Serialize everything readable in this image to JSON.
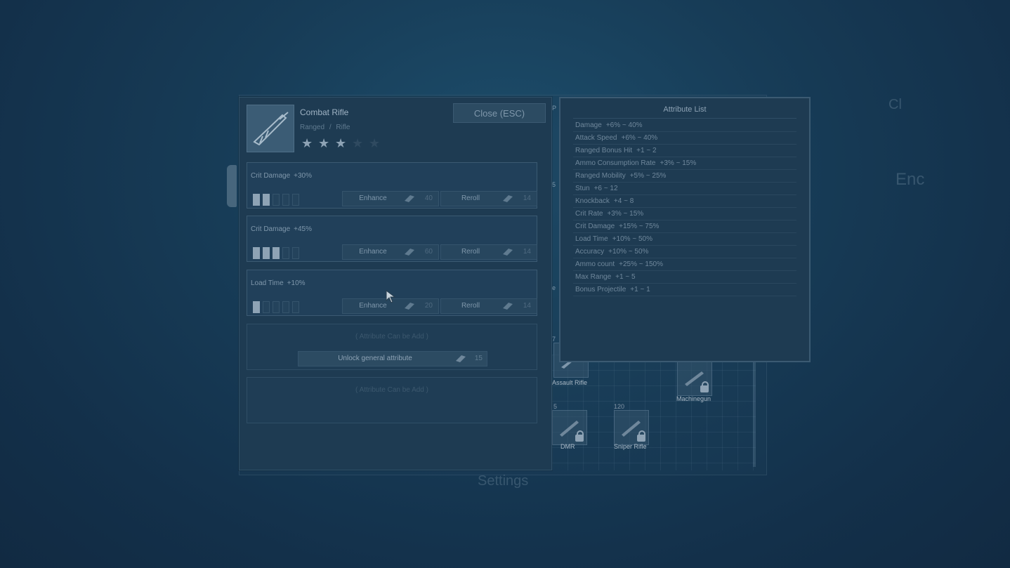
{
  "background": {
    "right_texts": [
      "Enc",
      "Cl"
    ],
    "settings_label": "Settings",
    "side_marks": [
      "P",
      "5",
      "e",
      "7"
    ],
    "weapons": [
      {
        "label": "Assault Rifle",
        "locked": false,
        "cost": ""
      },
      {
        "label": "Machinegun",
        "locked": true,
        "cost": ""
      },
      {
        "label": "DMR",
        "locked": true,
        "cost": "5"
      },
      {
        "label": "Sniper Rifle",
        "locked": true,
        "cost": "120"
      }
    ]
  },
  "item": {
    "name": "Combat Rifle",
    "category": "Ranged",
    "separator": "/",
    "subcategory": "Rifle",
    "stars_filled": 3,
    "stars_total": 5,
    "icon": "rifle-icon"
  },
  "close_button": "Close (ESC)",
  "attributes": [
    {
      "name": "Crit Damage",
      "value": "+30%",
      "level": 2,
      "max_level": 5,
      "enhance_label": "Enhance",
      "enhance_cost": "40",
      "reroll_label": "Reroll",
      "reroll_cost": "14"
    },
    {
      "name": "Crit Damage",
      "value": "+45%",
      "level": 3,
      "max_level": 5,
      "enhance_label": "Enhance",
      "enhance_cost": "60",
      "reroll_label": "Reroll",
      "reroll_cost": "14"
    },
    {
      "name": "Load Time",
      "value": "+10%",
      "level": 1,
      "max_level": 5,
      "enhance_label": "Enhance",
      "enhance_cost": "20",
      "reroll_label": "Reroll",
      "reroll_cost": "14"
    }
  ],
  "empty_slots": [
    {
      "hint": "( Attribute Can be Add )",
      "unlock_label": "Unlock general attribute",
      "unlock_cost": "15"
    },
    {
      "hint": "( Attribute Can be Add )"
    }
  ],
  "attribute_list": {
    "title": "Attribute List",
    "rows": [
      {
        "name": "Damage",
        "range": "+6% ~ 40%"
      },
      {
        "name": "Attack Speed",
        "range": "+6% ~ 40%"
      },
      {
        "name": "Ranged Bonus Hit",
        "range": "+1 ~ 2"
      },
      {
        "name": "Ammo Consumption Rate",
        "range": "+3% ~ 15%"
      },
      {
        "name": "Ranged Mobility",
        "range": "+5% ~ 25%"
      },
      {
        "name": "Stun",
        "range": "+6 ~ 12"
      },
      {
        "name": "Knockback",
        "range": "+4 ~ 8"
      },
      {
        "name": "Crit Rate",
        "range": "+3% ~ 15%"
      },
      {
        "name": "Crit Damage",
        "range": "+15% ~ 75%"
      },
      {
        "name": "Load Time",
        "range": "+10% ~ 50%"
      },
      {
        "name": "Accuracy",
        "range": "+10% ~ 50%"
      },
      {
        "name": "Ammo count",
        "range": "+25% ~ 150%"
      },
      {
        "name": "Max Range",
        "range": "+1 ~ 5"
      },
      {
        "name": "Bonus Projectile",
        "range": "+1 ~ 1"
      }
    ]
  },
  "colors": {
    "panel": "#1e3b52",
    "border": "#3b5a72",
    "text": "#8ea3b5",
    "pip_on": "#8ea3b5"
  }
}
